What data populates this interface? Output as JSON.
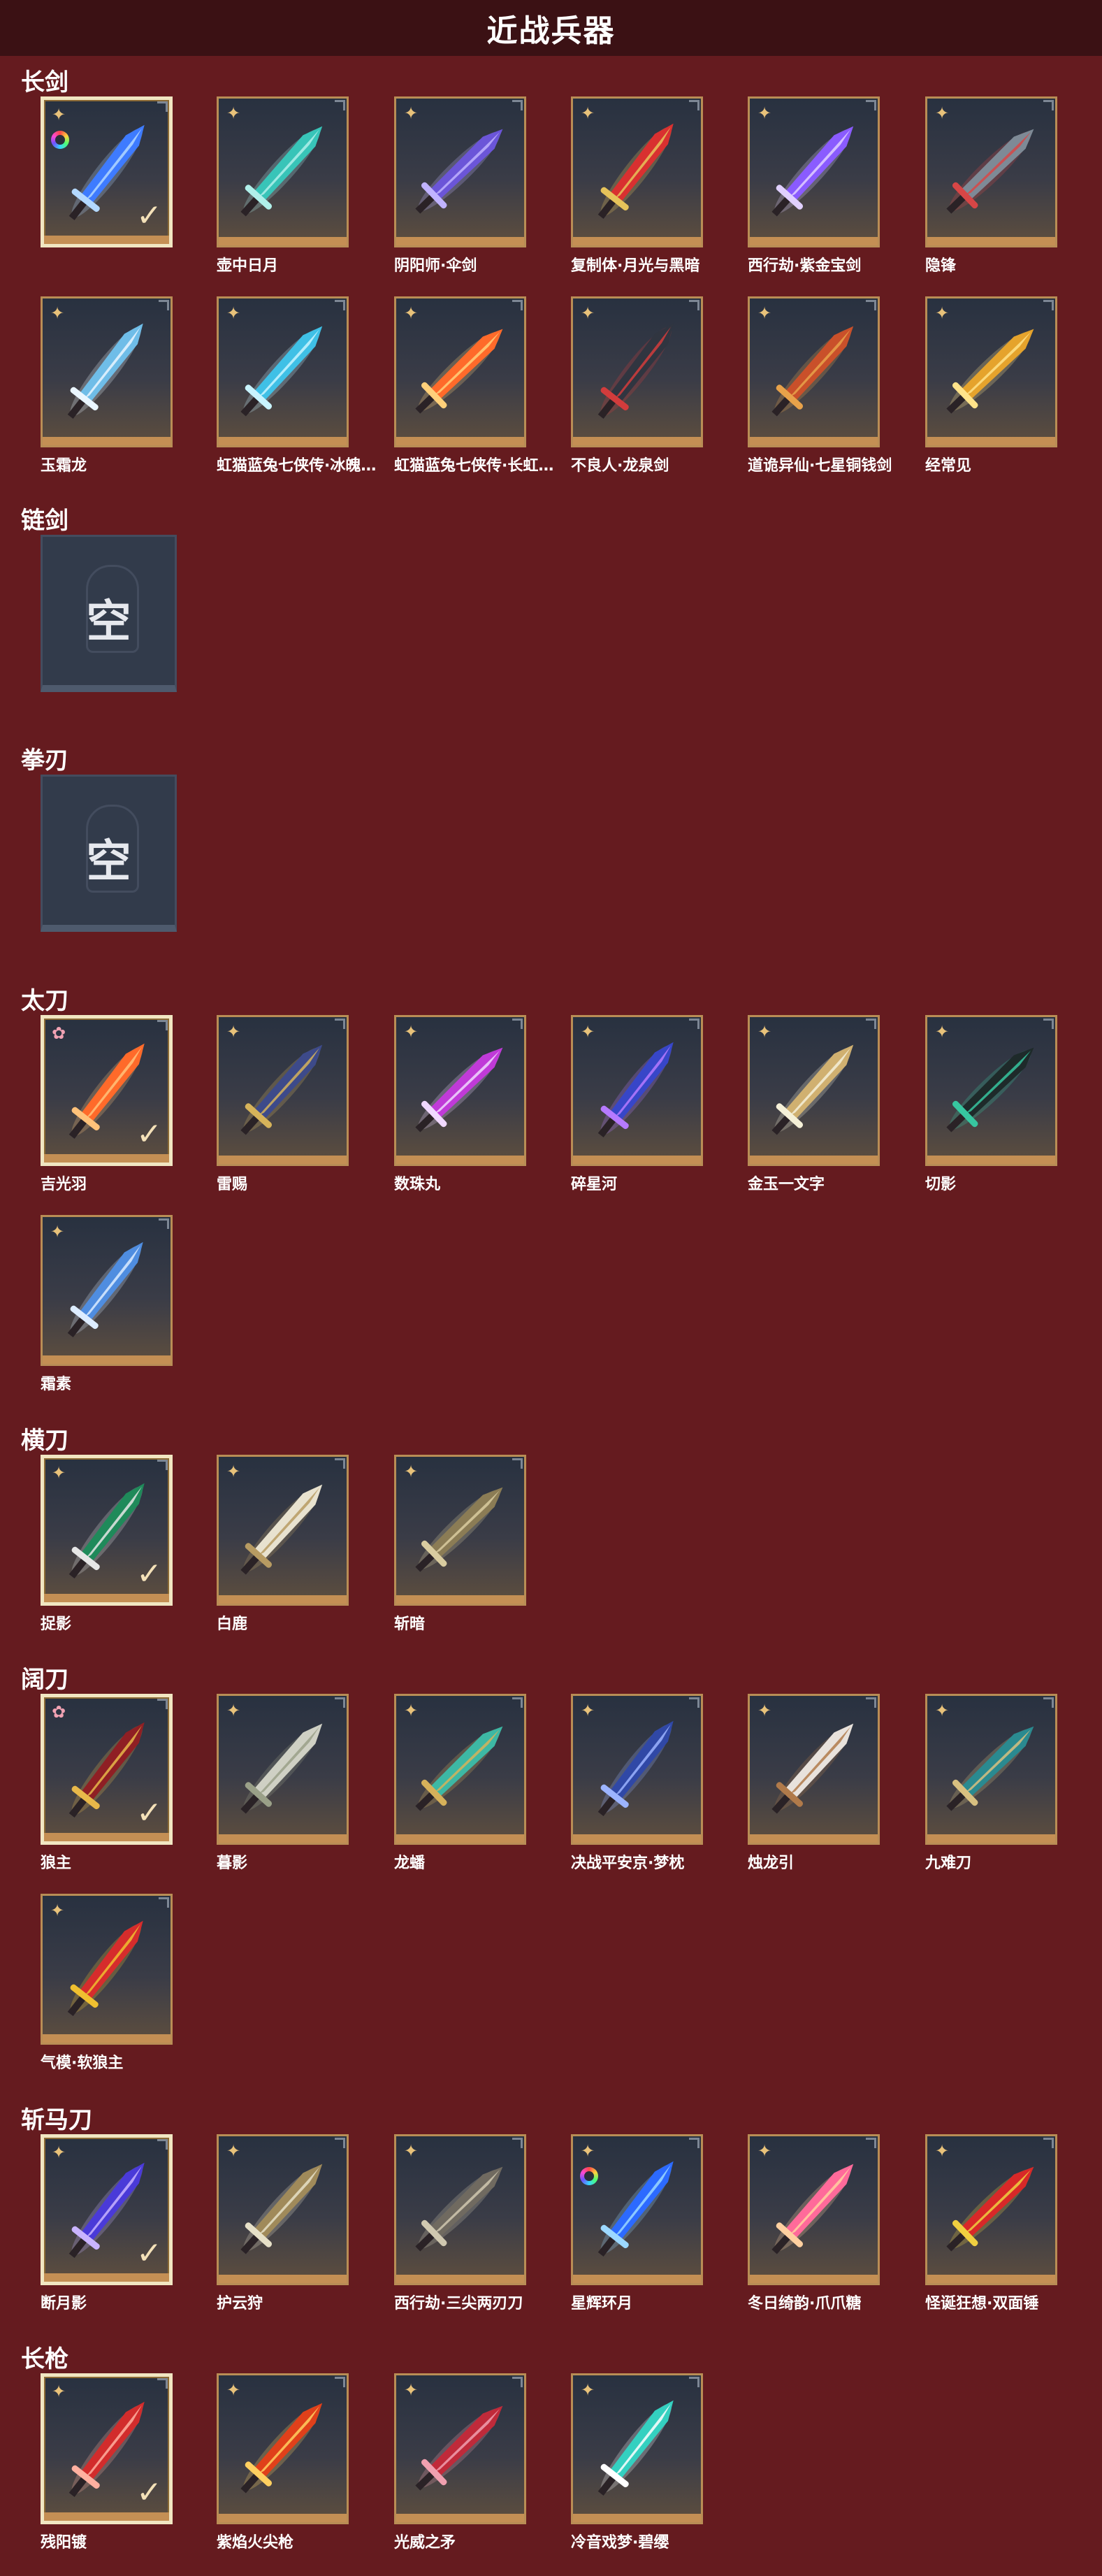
{
  "title": "近战兵器",
  "sections": [
    {
      "name": "长剑",
      "items": [
        {
          "label": "",
          "selected": true,
          "rarity": "gold",
          "color_icon": true,
          "colors": [
            "#3e7bff",
            "#b3d8ff"
          ]
        },
        {
          "label": "壶中日月",
          "rarity": "gold",
          "colors": [
            "#38c4b8",
            "#b0f0ea"
          ]
        },
        {
          "label": "阴阳师·伞剑",
          "rarity": "gold",
          "colors": [
            "#6b55d8",
            "#c0b3ff"
          ]
        },
        {
          "label": "复制体·月光与黑暗",
          "rarity": "gold",
          "colors": [
            "#d93030",
            "#e6c35a"
          ]
        },
        {
          "label": "西行劫·紫金宝剑",
          "rarity": "gold",
          "colors": [
            "#8a5bff",
            "#e0d0ff"
          ]
        },
        {
          "label": "隐锋",
          "rarity": "gold",
          "colors": [
            "#7e8a96",
            "#d74646"
          ]
        },
        {
          "label": "玉霜龙",
          "rarity": "gold",
          "colors": [
            "#6fbde8",
            "#eaf6ff"
          ]
        },
        {
          "label": "虹猫蓝兔七侠传·冰魄…",
          "rarity": "gold",
          "colors": [
            "#3fc0e6",
            "#c8f4ff"
          ]
        },
        {
          "label": "虹猫蓝兔七侠传·长虹…",
          "rarity": "gold",
          "colors": [
            "#ff6a2a",
            "#ffd07a"
          ]
        },
        {
          "label": "不良人·龙泉剑",
          "rarity": "gold",
          "colors": [
            "#303540",
            "#d23c3c"
          ]
        },
        {
          "label": "道诡异仙·七星铜钱剑",
          "rarity": "gold",
          "colors": [
            "#c9502a",
            "#e8a24a"
          ]
        },
        {
          "label": "经常见",
          "rarity": "gold",
          "colors": [
            "#e5a32c",
            "#ffe38a"
          ]
        }
      ]
    },
    {
      "name": "链剑",
      "empty": true,
      "empty_text": "空"
    },
    {
      "name": "拳刃",
      "empty": true,
      "empty_text": "空"
    },
    {
      "name": "太刀",
      "items": [
        {
          "label": "吉光羽",
          "selected": true,
          "rarity": "pink",
          "colors": [
            "#ff6a2a",
            "#ffc27a"
          ]
        },
        {
          "label": "雷赐",
          "rarity": "gold",
          "colors": [
            "#3d4a8a",
            "#d6b35a"
          ]
        },
        {
          "label": "数珠丸",
          "rarity": "gold",
          "colors": [
            "#c03ad8",
            "#f0d8ff"
          ]
        },
        {
          "label": "碎星河",
          "rarity": "gold",
          "colors": [
            "#3746c8",
            "#b67aff"
          ]
        },
        {
          "label": "金玉一文字",
          "rarity": "gold",
          "colors": [
            "#d0b070",
            "#f5f0d8"
          ]
        },
        {
          "label": "切影",
          "rarity": "gold",
          "colors": [
            "#1e2a2a",
            "#37c6a0"
          ]
        },
        {
          "label": "霜素",
          "rarity": "gold",
          "colors": [
            "#4f8de0",
            "#dcecff"
          ]
        }
      ]
    },
    {
      "name": "横刀",
      "items": [
        {
          "label": "捉影",
          "selected": true,
          "rarity": "gold",
          "colors": [
            "#1f8a5a",
            "#e6e6e6"
          ]
        },
        {
          "label": "白鹿",
          "rarity": "gold",
          "colors": [
            "#e8e2cf",
            "#b79b62"
          ]
        },
        {
          "label": "斩暗",
          "rarity": "gold",
          "colors": [
            "#8b7c55",
            "#d9cca0"
          ]
        }
      ]
    },
    {
      "name": "阔刀",
      "items": [
        {
          "label": "狼主",
          "selected": true,
          "rarity": "pink",
          "colors": [
            "#8f1f24",
            "#e8b84a"
          ]
        },
        {
          "label": "暮影",
          "rarity": "gold",
          "colors": [
            "#cfd0c4",
            "#9aa088"
          ]
        },
        {
          "label": "龙蟠",
          "rarity": "gold",
          "colors": [
            "#3db8a4",
            "#d6b15a"
          ]
        },
        {
          "label": "决战平安京·梦枕",
          "rarity": "gold",
          "colors": [
            "#3048a6",
            "#9cb4ff"
          ]
        },
        {
          "label": "烛龙引",
          "rarity": "gold",
          "colors": [
            "#e8e2dc",
            "#b07a4a"
          ]
        },
        {
          "label": "九难刀",
          "rarity": "gold",
          "colors": [
            "#2a8a90",
            "#d8c080"
          ]
        },
        {
          "label": "气模·软狼主",
          "rarity": "gold",
          "colors": [
            "#d62c2c",
            "#f0c030"
          ]
        }
      ]
    },
    {
      "name": "斩马刀",
      "items": [
        {
          "label": "断月影",
          "selected": true,
          "rarity": "gold",
          "colors": [
            "#4a3ad8",
            "#c9b4ff"
          ]
        },
        {
          "label": "护云狩",
          "rarity": "gold",
          "colors": [
            "#a08a5a",
            "#e6e0c8"
          ]
        },
        {
          "label": "西行劫·三尖两刃刀",
          "rarity": "gold",
          "colors": [
            "#706a60",
            "#d0c8b0"
          ]
        },
        {
          "label": "星辉环月",
          "rarity": "gold",
          "color_icon": true,
          "colors": [
            "#2c6aff",
            "#9cd8ff"
          ]
        },
        {
          "label": "冬日绮韵·爪爪糖",
          "rarity": "gold",
          "colors": [
            "#ff6a9a",
            "#ffd0a0"
          ]
        },
        {
          "label": "怪诞狂想·双面锤",
          "rarity": "gold",
          "colors": [
            "#d82828",
            "#f0d040"
          ]
        }
      ]
    },
    {
      "name": "长枪",
      "items": [
        {
          "label": "残阳镀",
          "selected": true,
          "rarity": "gold",
          "colors": [
            "#d22c2c",
            "#ffb0a0"
          ]
        },
        {
          "label": "紫焰火尖枪",
          "rarity": "gold",
          "colors": [
            "#e0401a",
            "#ffd060"
          ]
        },
        {
          "label": "光威之矛",
          "rarity": "gold",
          "colors": [
            "#c02a3a",
            "#f0a0b0"
          ]
        },
        {
          "label": "冷音戏梦·碧缨",
          "rarity": "gold",
          "colors": [
            "#34d0c0",
            "#ffffff"
          ]
        }
      ]
    }
  ]
}
